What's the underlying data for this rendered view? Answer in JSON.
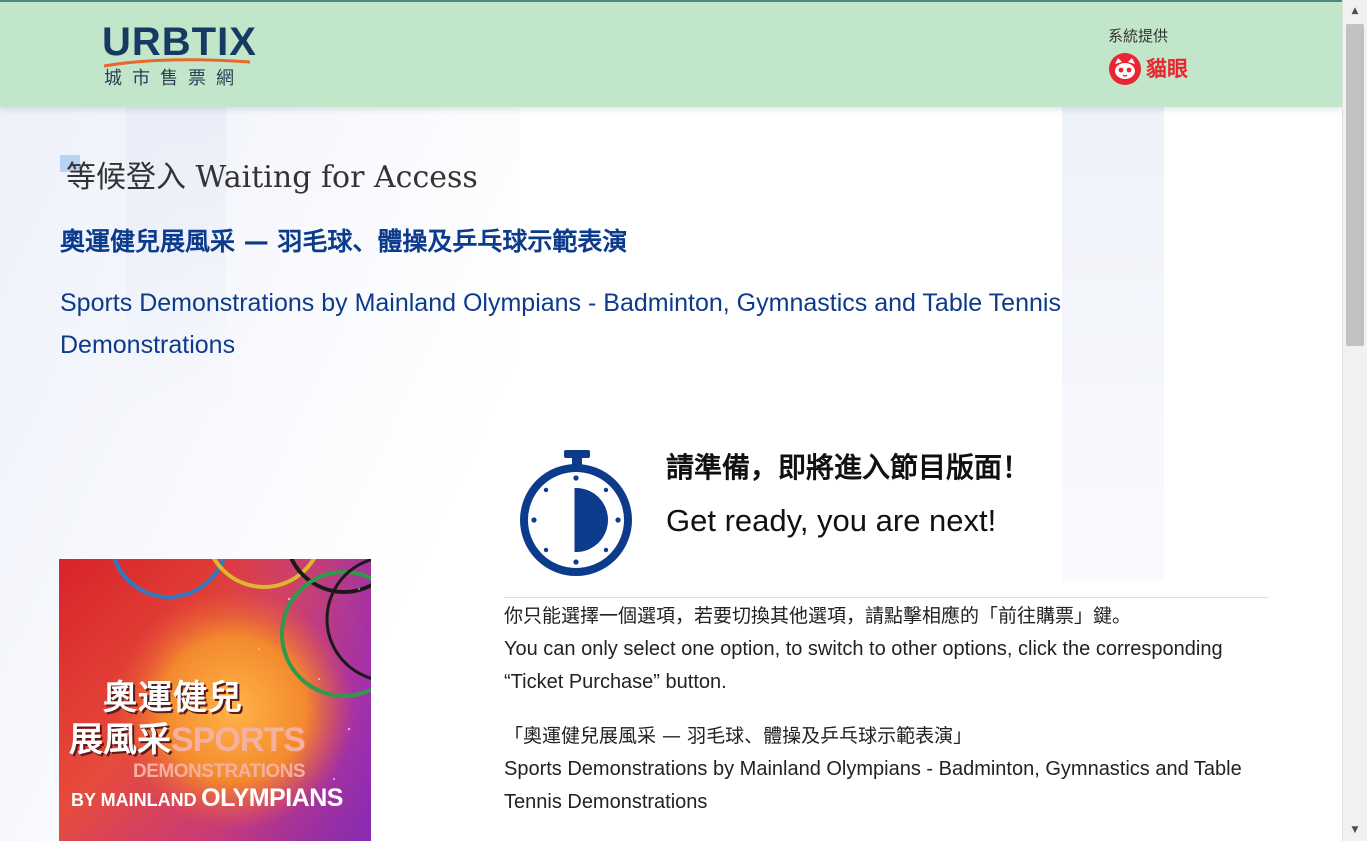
{
  "header": {
    "logo_text": "URBTIX",
    "logo_subtitle": "城市售票網",
    "provider_label": "系統提供",
    "provider_name": "貓眼",
    "provider_icon": "cat-eye-logo-icon",
    "bg_color": "#c2e6c9"
  },
  "main": {
    "page_title": "等候登入 Waiting for Access",
    "event_title_zh": "奧運健兒展風采 — 羽毛球、體操及乒乓球示範表演",
    "event_title_en": "Sports Demonstrations by Mainland Olympians - Badminton, Gymnastics and Table Tennis Demonstrations",
    "poster": {
      "line1": "奧運健兒",
      "line2_zh": "展風采",
      "line2_en": "SPORTS",
      "line3": "DEMONSTRATIONS",
      "line4_by": "BY MAINLAND",
      "line4_olympians": "OLYMPIANS"
    },
    "timer_icon": "stopwatch-icon",
    "ready_zh": "請準備，即將進入節目版面！",
    "ready_en": "Get ready, you are next!",
    "note_zh": "你只能選擇一個選項，若要切換其他選項，請點擊相應的「前往購票」鍵。",
    "note_en": "You can only select one option, to switch to other options, click the corresponding “Ticket Purchase” button.",
    "selected_zh": "「奧運健兒展風采 — 羽毛球、體操及乒乓球示範表演」",
    "selected_en": "Sports Demonstrations by Mainland Olympians - Badminton, Gymnastics and Table Tennis Demonstrations"
  },
  "colors": {
    "accent_blue": "#0d3b8c",
    "brand_red": "#e8262f",
    "logo_navy": "#173a63"
  },
  "scrollbar": {
    "up_icon": "arrow-up-icon",
    "down_icon": "arrow-down-icon"
  }
}
